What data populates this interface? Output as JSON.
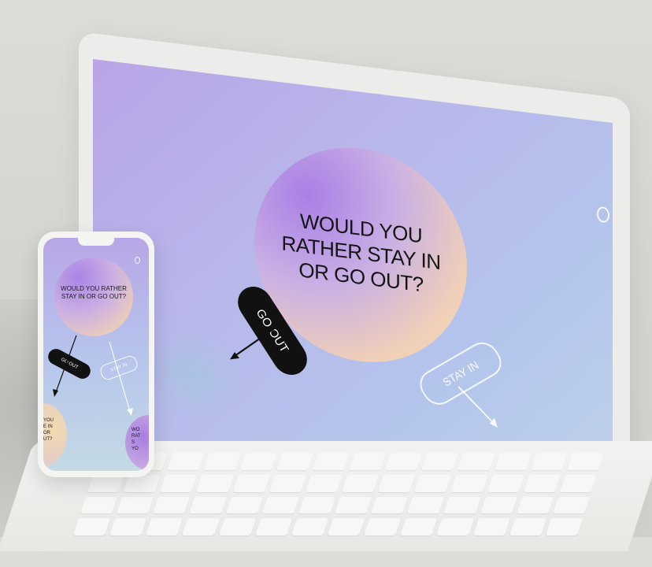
{
  "screen": {
    "question": "WOULD YOU RATHER STAY IN OR GO OUT?",
    "button_go_out": "GO OUT",
    "button_stay_in": "STAY IN"
  },
  "phone": {
    "question": "WOULD YOU RATHER STAY IN OR GO OUT?",
    "button_go_out": "GO OUT",
    "button_stay_in": "STAY IN",
    "side_left": "YOU\nE IN\nOR\nUT?",
    "side_right": "WO\nRAT\nS\nYO"
  },
  "colors": {
    "accent_purple": "#a97fe6",
    "accent_peach": "#f3ddb0",
    "button_dark": "#111111",
    "background": "#b8b6ea"
  },
  "icons": [
    "logo-icon",
    "arrow-down-left-icon",
    "arrow-down-right-icon"
  ]
}
